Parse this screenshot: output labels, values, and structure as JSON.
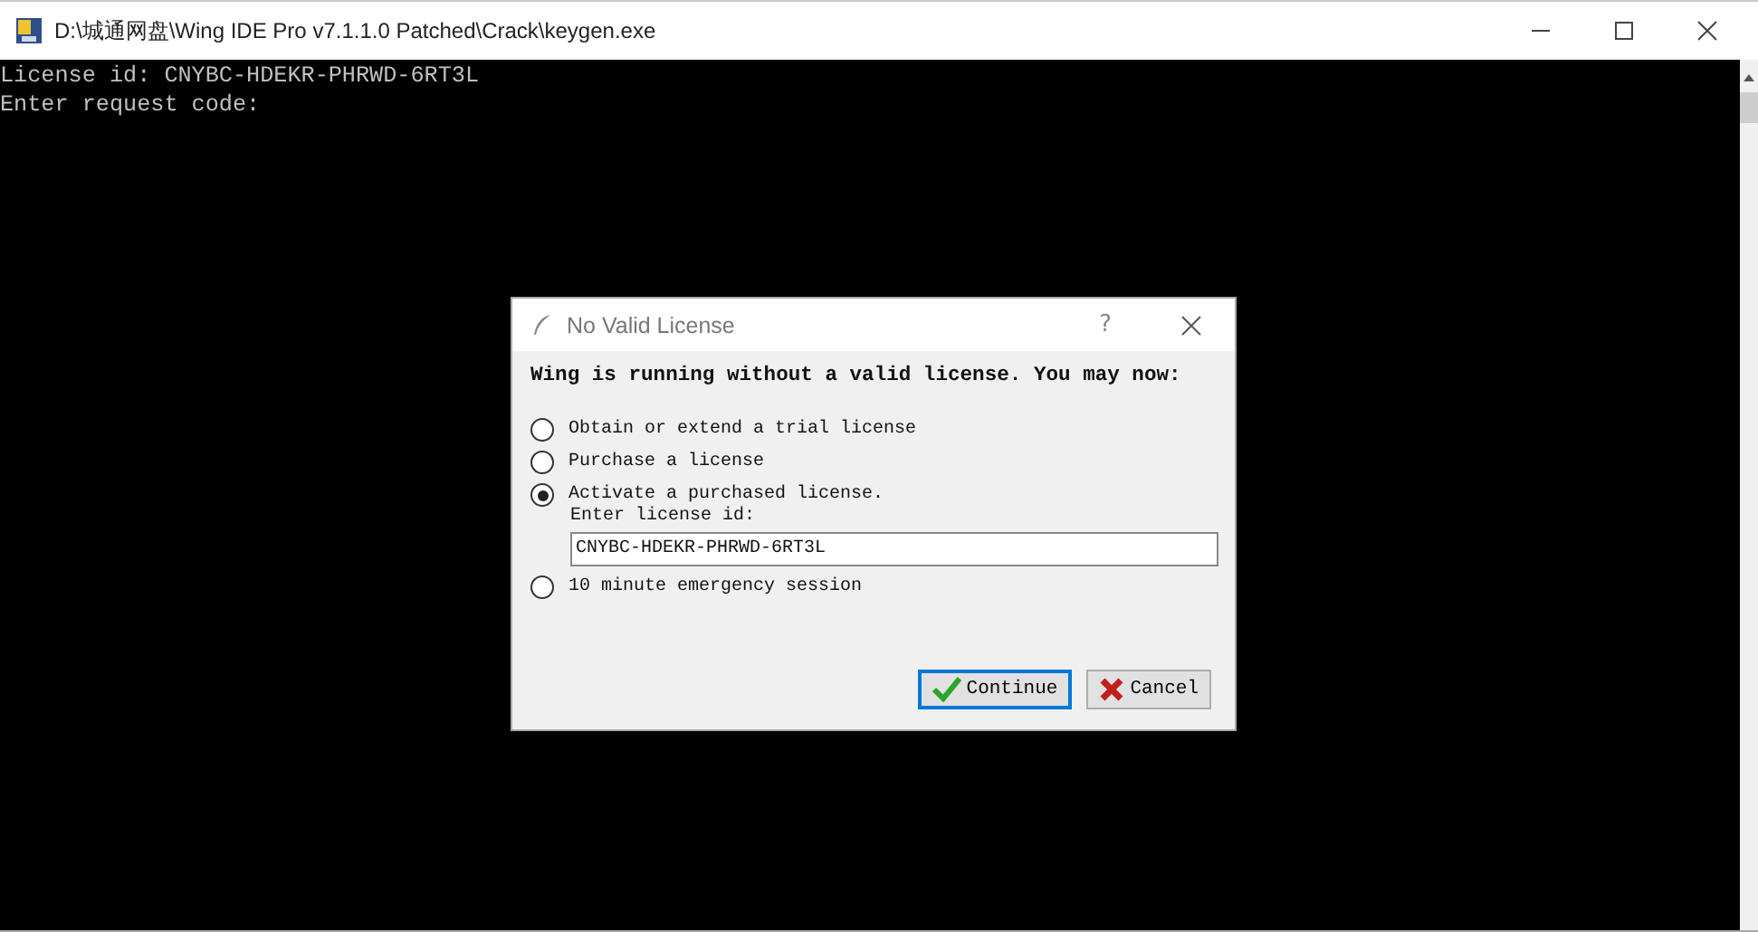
{
  "window": {
    "title": "D:\\城通网盘\\Wing IDE Pro v7.1.1.0 Patched\\Crack\\keygen.exe"
  },
  "console": {
    "lines": [
      "License id: CNYBC-HDEKR-PHRWD-6RT3L",
      "Enter request code:"
    ]
  },
  "dialog": {
    "title": "No Valid License",
    "help": "?",
    "message": "Wing is running without a valid license. You may now:",
    "options": [
      {
        "label": "Obtain or extend a trial license",
        "selected": false
      },
      {
        "label": "Purchase a license",
        "selected": false
      },
      {
        "label": "Activate a purchased license.",
        "selected": true,
        "field": {
          "label": "Enter license id:",
          "value": "CNYBC-HDEKR-PHRWD-6RT3L"
        }
      },
      {
        "label": "10 minute emergency session",
        "selected": false
      }
    ],
    "buttons": [
      {
        "label": "Continue",
        "kind": "ok",
        "focused": true
      },
      {
        "label": "Cancel",
        "kind": "cancel",
        "focused": false
      }
    ]
  }
}
